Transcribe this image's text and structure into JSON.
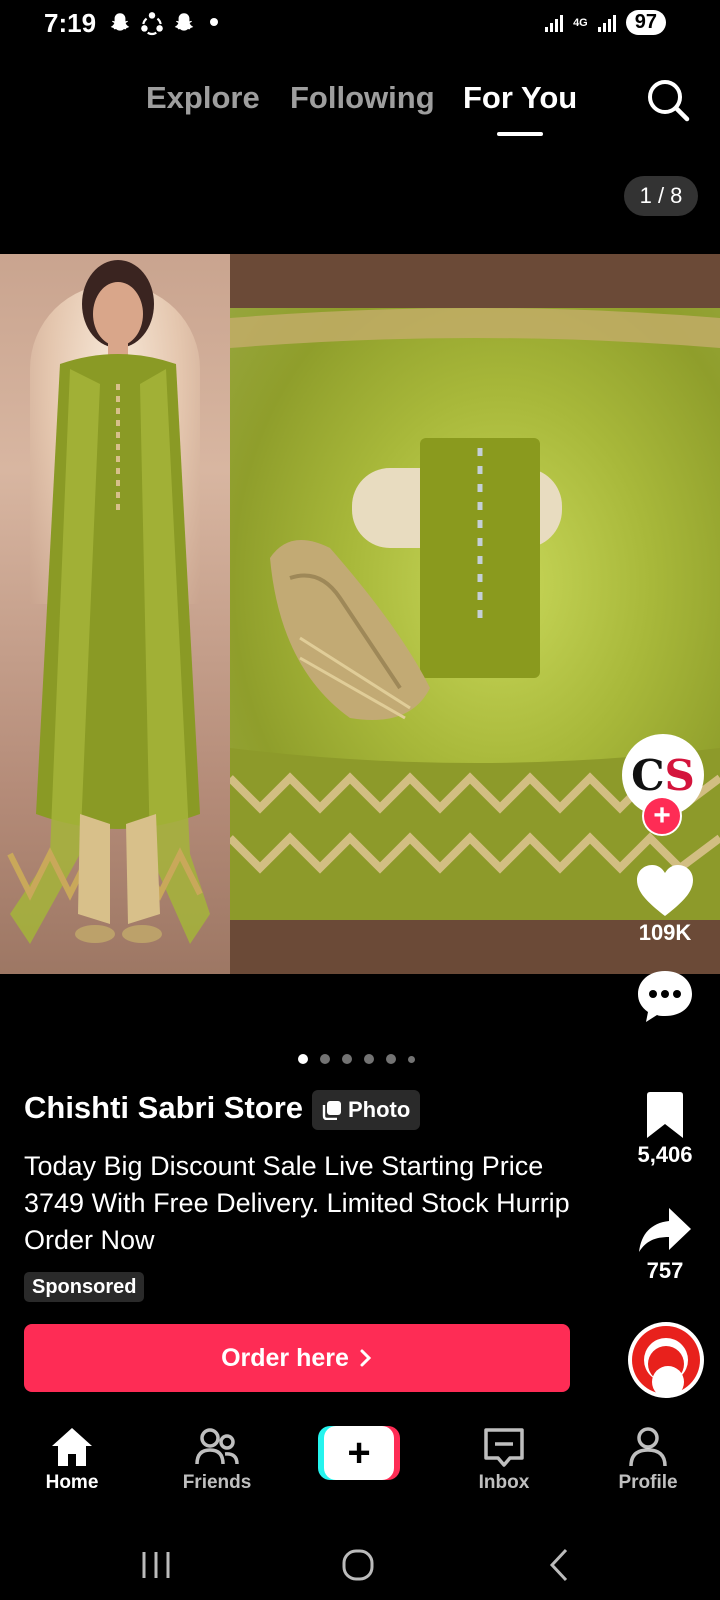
{
  "status_bar": {
    "time": "7:19",
    "network": "4G",
    "battery": "97",
    "icons": [
      "snapchat-icon",
      "sync-icon",
      "snapchat-icon",
      "signal-icon",
      "signal-icon"
    ]
  },
  "top_tabs": {
    "explore": "Explore",
    "following": "Following",
    "for_you": "For You",
    "active": "For You"
  },
  "photo_counter": "1 / 8",
  "carousel": {
    "total_dots": 6,
    "active_index": 0
  },
  "post": {
    "author": "Chishti Sabri Store",
    "type_badge": "Photo",
    "caption": "Today Big Discount Sale Live Starting Price 3749 With Free Delivery. Limited Stock Hurrip Order Now",
    "sponsored": "Sponsored",
    "cta": "Order here"
  },
  "actions": {
    "likes": "109K",
    "saves": "5,406",
    "shares": "757"
  },
  "avatar_letters": "CS",
  "bottom_nav": {
    "home": "Home",
    "friends": "Friends",
    "inbox": "Inbox",
    "profile": "Profile"
  },
  "colors": {
    "accent": "#fe2c55",
    "create_cyan": "#25f4ee",
    "background": "#000000"
  }
}
